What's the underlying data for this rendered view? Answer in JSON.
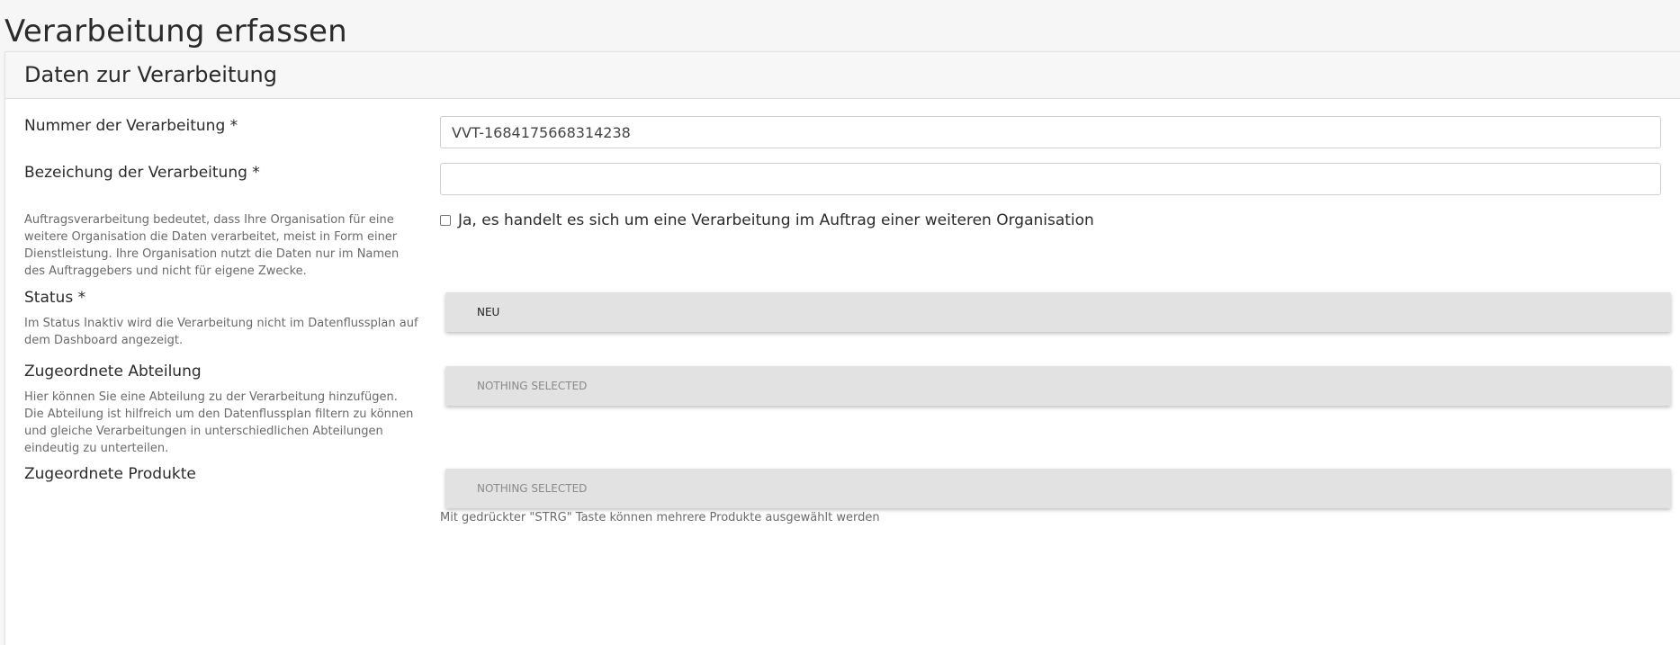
{
  "page": {
    "title": "Verarbeitung erfassen"
  },
  "card": {
    "title": "Daten zur Verarbeitung"
  },
  "fields": {
    "number": {
      "label": "Nummer der Verarbeitung *",
      "value": "VVT-1684175668314238"
    },
    "designation": {
      "label": "Bezeichung der Verarbeitung *",
      "value": ""
    },
    "order_processing": {
      "help": "Auftragsverarbeitung bedeutet, dass Ihre Organisation für eine weitere Organisation die Daten verarbeitet, meist in Form einer Dienstleistung. Ihre Organisation nutzt die Daten nur im Namen des Auftraggebers und nicht für eigene Zwecke.",
      "checkbox_label": "Ja, es handelt es sich um eine Verarbeitung im Auftrag einer weiteren Organisation",
      "checked": false
    },
    "status": {
      "label": "Status *",
      "help": "Im Status Inaktiv wird die Verarbeitung nicht im Datenflussplan auf dem Dashboard angezeigt.",
      "selected": "NEU"
    },
    "department": {
      "label": "Zugeordnete Abteilung",
      "help": "Hier können Sie eine Abteilung zu der Verarbeitung hinzufügen. Die Abteilung ist hilfreich um den Datenflussplan filtern zu können und gleiche Verarbeitungen in unterschiedlichen Abteilungen eindeutig zu unterteilen.",
      "selected": "NOTHING SELECTED"
    },
    "products": {
      "label": "Zugeordnete Produkte",
      "selected": "NOTHING SELECTED",
      "hint": "Mit gedrückter \"STRG\" Taste können mehrere Produkte ausgewählt werden"
    }
  },
  "colors": {
    "select_background": "#e2e2e2",
    "header_background": "#f7f7f7",
    "page_background": "#f6f6f6"
  }
}
